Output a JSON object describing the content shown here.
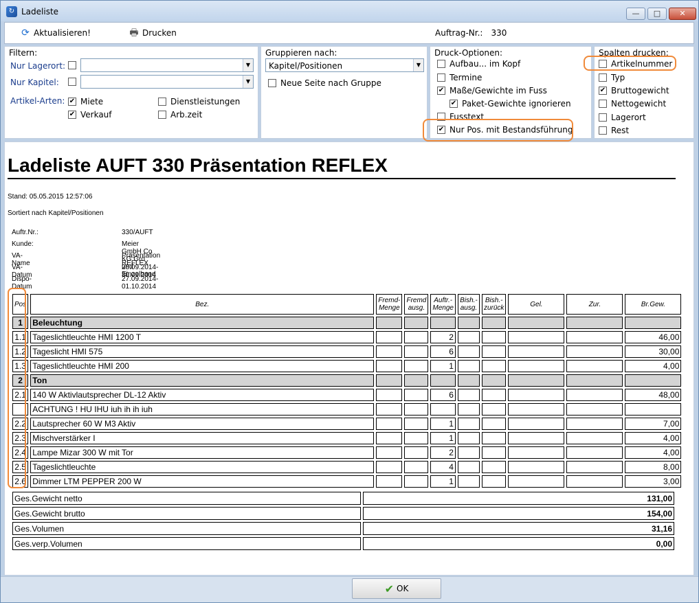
{
  "window": {
    "title": "Ladeliste",
    "minimize": "—",
    "maximize": "□",
    "close": "✕"
  },
  "toolbar": {
    "refresh_label": "Aktualisieren!",
    "print_label": "Drucken",
    "order_label": "Auftrag-Nr.:",
    "order_value": "330"
  },
  "filter": {
    "title": "Filtern:",
    "lagerort_label": "Nur Lagerort:",
    "kapitel_label": "Nur Kapitel:",
    "artikel_arten_label": "Artikel-Arten:",
    "miete": "Miete",
    "verkauf": "Verkauf",
    "dienstleistungen": "Dienstleistungen",
    "arbzeit": "Arb.zeit"
  },
  "group": {
    "title": "Gruppieren nach:",
    "selected": "Kapitel/Positionen",
    "new_page": "Neue Seite nach Gruppe"
  },
  "print_options": {
    "title": "Druck-Optionen:",
    "aufbau": "Aufbau... im Kopf",
    "termine": "Termine",
    "masse": "Maße/Gewichte im Fuss",
    "paket": "Paket-Gewichte ignorieren",
    "fusstext": "Fusstext",
    "nur_pos": "Nur Pos. mit Bestandsführung"
  },
  "columns_print": {
    "title": "Spalten drucken:",
    "artikelnummer": "Artikelnummer",
    "typ": "Typ",
    "brutto": "Bruttogewicht",
    "netto": "Nettogewicht",
    "lagerort": "Lagerort",
    "rest": "Rest"
  },
  "report": {
    "title": "Ladeliste AUFT 330 Präsentation REFLEX",
    "stand": "Stand: 05.05.2015 12:57:06",
    "sorted": "Sortiert nach Kapitel/Positionen",
    "meta": [
      {
        "k": "Auftr.Nr.:",
        "v": "330/AUFT"
      },
      {
        "k": "Kunde:",
        "v": "Meier GmbH Co KG Gro und Einzelhand"
      },
      {
        "k": "VA-Name",
        "v": "Präsentation REFLEX"
      },
      {
        "k": "VA-Datum",
        "v": "28.09.2014-30.09.2014"
      },
      {
        "k": "Dispo-Datum",
        "v": "27.09.2014-01.10.2014"
      }
    ],
    "headers": {
      "pos": "Pos",
      "bez": "Bez.",
      "fremd_menge": "Fremd-\nMenge",
      "fremd_ausg": "Fremd\nausg.",
      "auftr_menge": "Auftr.-\nMenge",
      "bish_ausg": "Bish.-\nausg.",
      "bish_zurueck": "Bish.-\nzurück",
      "gel": "Gel.",
      "zur": "Zur.",
      "brgew": "Br.Gew."
    },
    "rows": [
      {
        "group": true,
        "pos": "1",
        "bez": "Beleuchtung",
        "menge": "",
        "gew": ""
      },
      {
        "group": false,
        "pos": "1.1",
        "bez": "Tageslichtleuchte HMI 1200 T",
        "menge": "2",
        "gew": "46,00"
      },
      {
        "group": false,
        "pos": "1.2",
        "bez": "Tageslicht HMI 575",
        "menge": "6",
        "gew": "30,00"
      },
      {
        "group": false,
        "pos": "1.3",
        "bez": "Tageslichtleuchte HMI 200",
        "menge": "1",
        "gew": "4,00"
      },
      {
        "group": true,
        "pos": "2",
        "bez": "Ton",
        "menge": "",
        "gew": ""
      },
      {
        "group": false,
        "pos": "2.1",
        "bez": "140 W Aktivlautsprecher DL-12 Aktiv",
        "menge": "6",
        "gew": "48,00"
      },
      {
        "group": false,
        "pos": "",
        "bez": "ACHTUNG ! HU IHU iuh ih ih iuh",
        "menge": "",
        "gew": ""
      },
      {
        "group": false,
        "pos": "2.2",
        "bez": "Lautsprecher 60 W M3 Aktiv",
        "menge": "1",
        "gew": "7,00"
      },
      {
        "group": false,
        "pos": "2.3",
        "bez": "Mischverstärker I",
        "menge": "1",
        "gew": "4,00"
      },
      {
        "group": false,
        "pos": "2.4",
        "bez": "Lampe Mizar 300 W mit Tor",
        "menge": "2",
        "gew": "4,00"
      },
      {
        "group": false,
        "pos": "2.5",
        "bez": "Tageslichtleuchte",
        "menge": "4",
        "gew": "8,00"
      },
      {
        "group": false,
        "pos": "2.6",
        "bez": "Dimmer LTM PEPPER 200 W",
        "menge": "1",
        "gew": "3,00"
      }
    ],
    "totals": [
      {
        "label": "Ges.Gewicht netto",
        "value": "131,00"
      },
      {
        "label": "Ges.Gewicht brutto",
        "value": "154,00"
      },
      {
        "label": "Ges.Volumen",
        "value": "31,16"
      },
      {
        "label": "Ges.verp.Volumen",
        "value": "0,00"
      }
    ]
  },
  "footer": {
    "ok_label": "OK"
  }
}
